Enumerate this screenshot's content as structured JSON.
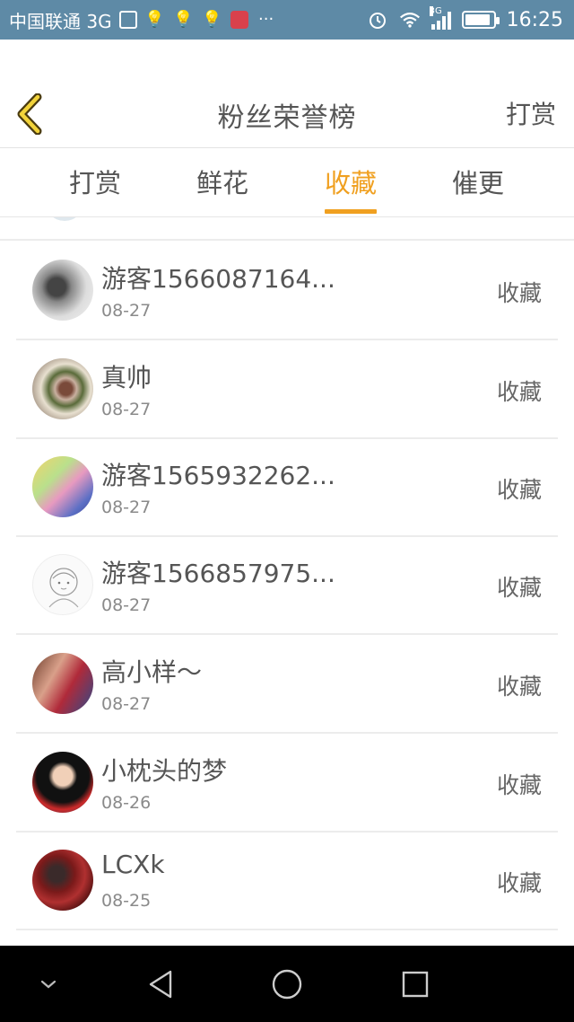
{
  "status_bar": {
    "carrier": "中国联通 3G",
    "network_tag": "3G",
    "time": "16:25",
    "battery_level": 0.9,
    "icons": [
      "image-icon",
      "bulb-icon",
      "bulb-icon",
      "bulb-icon",
      "app-icon",
      "more-icon",
      "alarm-icon",
      "wifi-icon",
      "signal-icon",
      "battery-icon"
    ]
  },
  "header": {
    "title": "粉丝荣誉榜",
    "right_action": "打赏",
    "back_icon": "chevron-left-icon",
    "accent_color": "#f0a020"
  },
  "tabs": [
    {
      "label": "打赏",
      "active": false
    },
    {
      "label": "鲜花",
      "active": false
    },
    {
      "label": "收藏",
      "active": true
    },
    {
      "label": "催更",
      "active": false
    }
  ],
  "list": {
    "items": [
      {
        "name": "游客1566087164...",
        "date": "08-27",
        "action": "收藏"
      },
      {
        "name": "真帅",
        "date": "08-27",
        "action": "收藏"
      },
      {
        "name": "游客1565932262...",
        "date": "08-27",
        "action": "收藏"
      },
      {
        "name": "游客1566857975...",
        "date": "08-27",
        "action": "收藏"
      },
      {
        "name": "高小样～",
        "date": "08-27",
        "action": "收藏"
      },
      {
        "name": "小枕头的梦",
        "date": "08-26",
        "action": "收藏"
      },
      {
        "name": "LCXk",
        "date": "08-25",
        "action": "收藏"
      }
    ]
  },
  "nav_bar": {
    "buttons": [
      "chevron-down-icon",
      "back-triangle-icon",
      "home-circle-icon",
      "recents-square-icon"
    ]
  }
}
